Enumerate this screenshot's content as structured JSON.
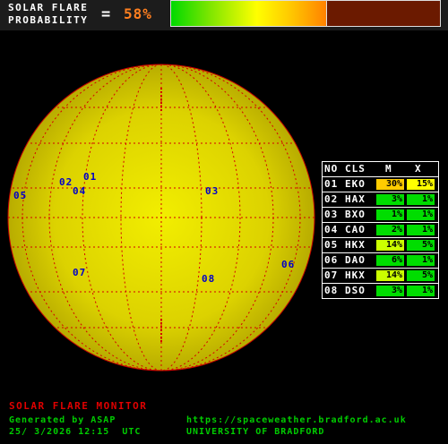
{
  "header": {
    "title_line1": "SOLAR FLARE",
    "title_line2": "PROBABILITY",
    "equals": "=",
    "probability": "58%",
    "probability_fraction": 0.58
  },
  "regions": [
    {
      "no": "01",
      "label": "01",
      "cls": "EKO",
      "m": "30%",
      "x": "15%",
      "m_color": "#ffcc00",
      "x_color": "#ffff00"
    },
    {
      "no": "02",
      "label": "02",
      "cls": "HAX",
      "m": "3%",
      "x": "1%",
      "m_color": "#00dd00",
      "x_color": "#00dd00"
    },
    {
      "no": "03",
      "label": "03",
      "cls": "BXO",
      "m": "1%",
      "x": "1%",
      "m_color": "#00dd00",
      "x_color": "#00dd00"
    },
    {
      "no": "04",
      "label": "04",
      "cls": "CAO",
      "m": "2%",
      "x": "1%",
      "m_color": "#00dd00",
      "x_color": "#00dd00"
    },
    {
      "no": "05",
      "label": "05",
      "cls": "HKX",
      "m": "14%",
      "x": "5%",
      "m_color": "#ccff00",
      "x_color": "#00dd00"
    },
    {
      "no": "06",
      "label": "06",
      "cls": "DAO",
      "m": "6%",
      "x": "1%",
      "m_color": "#00dd00",
      "x_color": "#00dd00"
    },
    {
      "no": "07",
      "label": "07",
      "cls": "HKX",
      "m": "14%",
      "x": "5%",
      "m_color": "#ccff00",
      "x_color": "#00dd00"
    },
    {
      "no": "08",
      "label": "08",
      "cls": "DSO",
      "m": "3%",
      "x": "1%",
      "m_color": "#00dd00",
      "x_color": "#00dd00"
    }
  ],
  "table_header": {
    "no": "NO",
    "cls": "CLS",
    "m": "M",
    "x": "X"
  },
  "footer": {
    "title": "SOLAR FLARE MONITOR",
    "generated": "Generated by ASAP",
    "datetime": "25/ 3/2026 12:15  UTC",
    "url": "https://spaceweather.bradford.ac.uk",
    "org": "UNIVERSITY OF BRADFORD"
  },
  "colors": {
    "accent": "#ff7f1f",
    "footer_title": "#e00000",
    "footer_text": "#00cc00",
    "region_label": "#0000c8"
  }
}
